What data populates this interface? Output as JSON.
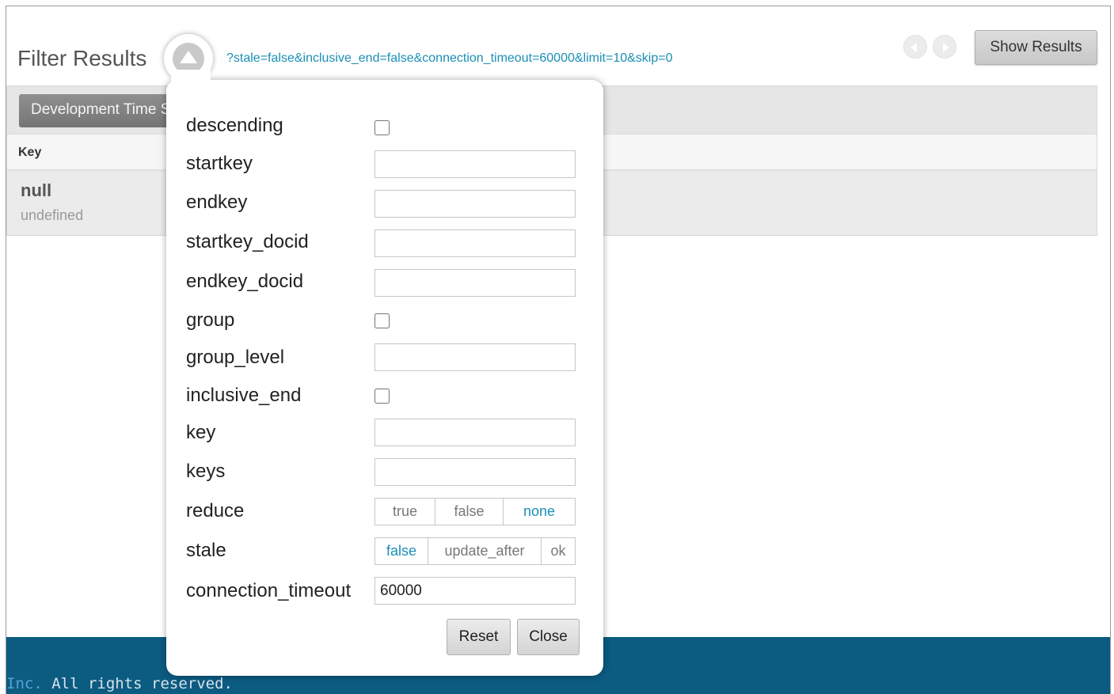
{
  "header": {
    "title": "Filter Results",
    "query_string": "?stale=false&inclusive_end=false&connection_timeout=60000&limit=10&skip=0",
    "show_results_label": "Show Results"
  },
  "results": {
    "tab_label": "Development Time Subset",
    "columns": {
      "key": "Key"
    },
    "rows": [
      {
        "key": "null",
        "value": "undefined"
      }
    ]
  },
  "filter_popup": {
    "options": {
      "descending": "descending",
      "startkey": "startkey",
      "endkey": "endkey",
      "startkey_docid": "startkey_docid",
      "endkey_docid": "endkey_docid",
      "group": "group",
      "group_level": "group_level",
      "inclusive_end": "inclusive_end",
      "key": "key",
      "keys": "keys",
      "reduce": "reduce",
      "stale": "stale",
      "connection_timeout": "connection_timeout"
    },
    "values": {
      "startkey": "",
      "endkey": "",
      "startkey_docid": "",
      "endkey_docid": "",
      "group_level": "",
      "key": "",
      "keys": "",
      "connection_timeout": "60000"
    },
    "reduce_choices": [
      "true",
      "false",
      "none"
    ],
    "reduce_selected": "none",
    "stale_choices": [
      "false",
      "update_after",
      "ok"
    ],
    "stale_selected": "false",
    "reset_label": "Reset",
    "close_label": "Close"
  },
  "footer": {
    "company_fragment": "Inc.",
    "rights_text": " All rights reserved."
  },
  "colors": {
    "accent": "#1a8fb6",
    "footer_bg": "#0c5b80",
    "tab_bg": "#7f7f7f"
  }
}
